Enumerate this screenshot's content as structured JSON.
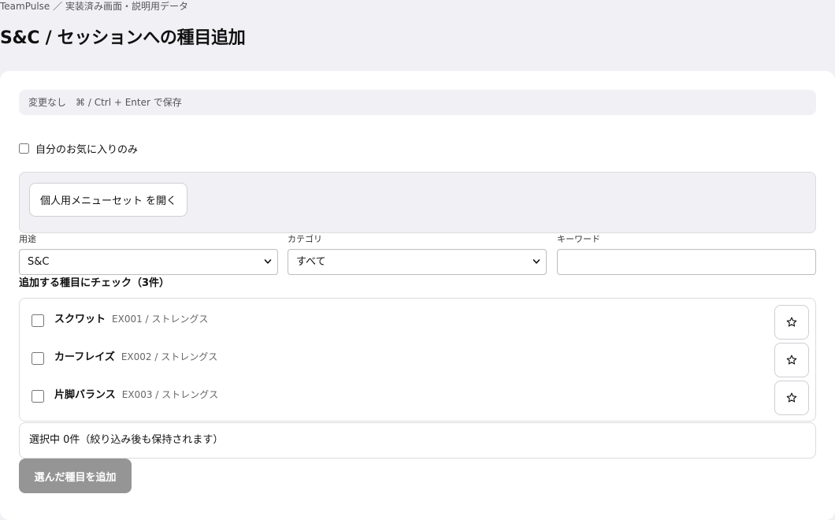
{
  "breadcrumb": "TeamPulse ／ 実装済み画面・説明用データ",
  "page_title": "S&C / セッションへの種目追加",
  "hint": {
    "status": "変更なし",
    "shortcut": "⌘ / Ctrl + Enter で保存"
  },
  "favorites_only_label": "自分のお気に入りのみ",
  "menu_set_button": "個人用メニューセット を開く",
  "filters": {
    "purpose_label": "用途",
    "purpose_value": "S&C",
    "category_label": "カテゴリ",
    "category_value": "すべて",
    "keyword_label": "キーワード",
    "keyword_value": "",
    "keyword_placeholder": ""
  },
  "list_title": "追加する種目にチェック（3件）",
  "exercises": [
    {
      "name": "スクワット",
      "meta": "EX001 / ストレングス",
      "checked": false,
      "favorite": false
    },
    {
      "name": "カーフレイズ",
      "meta": "EX002 / ストレングス",
      "checked": false,
      "favorite": false
    },
    {
      "name": "片脚バランス",
      "meta": "EX003 / ストレングス",
      "checked": false,
      "favorite": false
    }
  ],
  "selected_summary": "選択中 0件（絞り込み後も保持されます）",
  "add_button": "選んだ種目を追加",
  "icons": {
    "favorite": "star-outline-icon",
    "dropdown": "chevron-down-icon"
  }
}
